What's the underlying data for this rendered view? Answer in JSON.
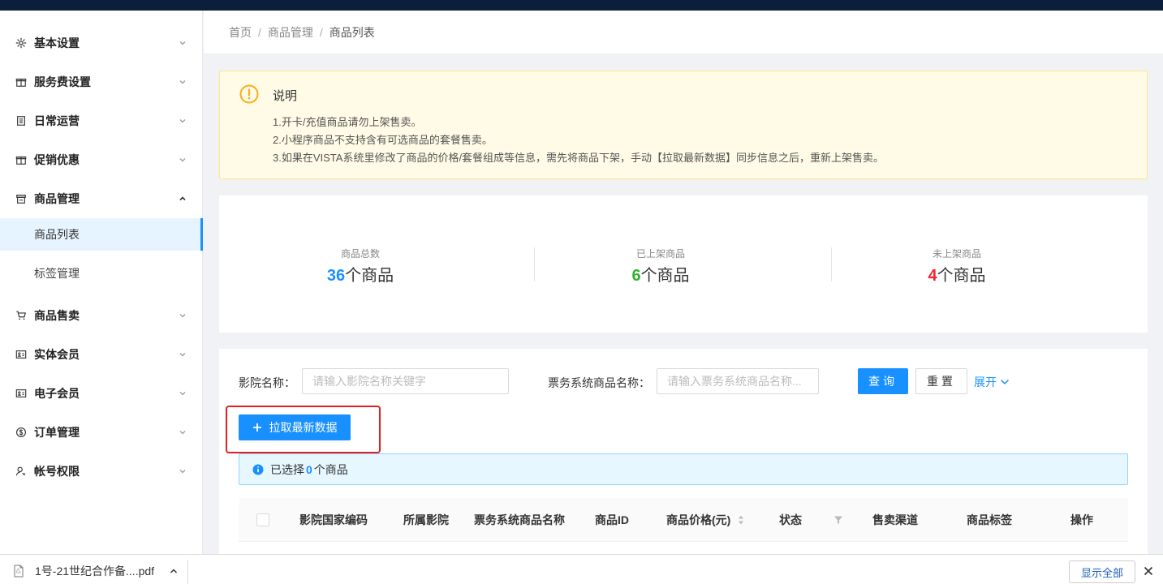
{
  "sidebar": {
    "items": [
      {
        "label": "基本设置",
        "icon": "gear-icon",
        "expanded": false
      },
      {
        "label": "服务费设置",
        "icon": "gift-icon",
        "expanded": false
      },
      {
        "label": "日常运营",
        "icon": "clipboard-icon",
        "expanded": false
      },
      {
        "label": "促销优惠",
        "icon": "gift-icon",
        "expanded": false
      },
      {
        "label": "商品管理",
        "icon": "store-icon",
        "expanded": true
      },
      {
        "label": "商品售卖",
        "icon": "cart-icon",
        "expanded": false
      },
      {
        "label": "实体会员",
        "icon": "member-card-icon",
        "expanded": false
      },
      {
        "label": "电子会员",
        "icon": "member-card-icon",
        "expanded": false
      },
      {
        "label": "订单管理",
        "icon": "dollar-icon",
        "expanded": false
      },
      {
        "label": "帐号权限",
        "icon": "user-key-icon",
        "expanded": false
      }
    ],
    "subitems": [
      {
        "label": "商品列表",
        "active": true
      },
      {
        "label": "标签管理",
        "active": false
      }
    ]
  },
  "breadcrumb": {
    "home": "首页",
    "section": "商品管理",
    "current": "商品列表",
    "separator": "/"
  },
  "notice": {
    "title": "说明",
    "lines": [
      "1.开卡/充值商品请勿上架售卖。",
      "2.小程序商品不支持含有可选商品的套餐售卖。",
      "3.如果在VISTA系统里修改了商品的价格/套餐组成等信息，需先将商品下架，手动【拉取最新数据】同步信息之后，重新上架售卖。"
    ]
  },
  "stats": [
    {
      "label": "商品总数",
      "number": "36",
      "unit": "个商品",
      "color": "#1890ff"
    },
    {
      "label": "已上架商品",
      "number": "6",
      "unit": "个商品",
      "color": "#2db32d"
    },
    {
      "label": "未上架商品",
      "number": "4",
      "unit": "个商品",
      "color": "#f5222d"
    }
  ],
  "filter": {
    "cinema_label": "影院名称：",
    "cinema_placeholder": "请输入影院名称关键字",
    "product_label": "票务系统商品名称：",
    "product_placeholder": "请输入票务系统商品名称...",
    "query": "查询",
    "reset": "重置",
    "expand": "展开"
  },
  "actions": {
    "pull_latest": "拉取最新数据"
  },
  "selection": {
    "prefix": "已选择",
    "count": "0",
    "suffix": "个商品"
  },
  "table": {
    "columns": [
      "影院国家编码",
      "所属影院",
      "票务系统商品名称",
      "商品ID",
      "商品价格(元)",
      "状态",
      "售卖渠道",
      "商品标签",
      "操作"
    ]
  },
  "download_bar": {
    "file_name": "1号-21世纪合作备....pdf",
    "show_all": "显示全部"
  },
  "colors": {
    "accent": "#1890ff",
    "highlight_box": "#e02020"
  }
}
